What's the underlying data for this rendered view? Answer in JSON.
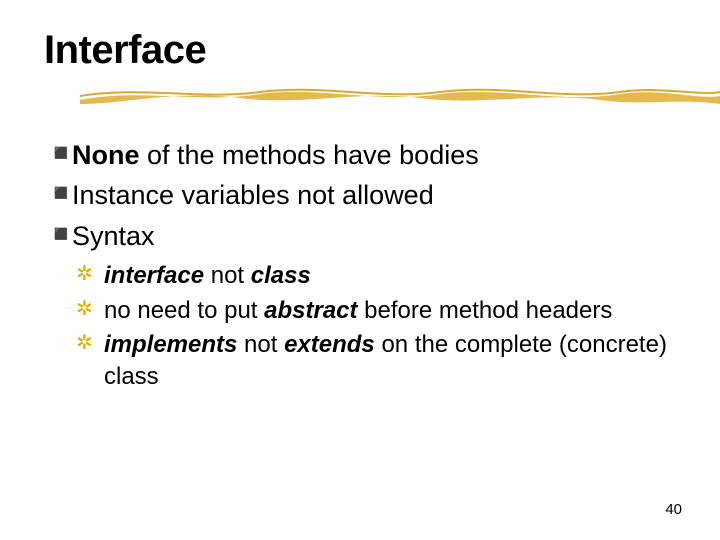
{
  "title": "Interface",
  "bullets": {
    "l1a": {
      "strong": "None",
      "rest": " of the methods have bodies"
    },
    "l1b": "Instance variables not allowed",
    "l1c": "Syntax"
  },
  "sub": {
    "s1": {
      "i1": "interface",
      "mid": " not ",
      "i2": "class"
    },
    "s2": {
      "pre": "no need to put ",
      "i1": "abstract",
      "post": " before method headers"
    },
    "s3": {
      "i1": "implements",
      "mid": " not ",
      "i2": "extends",
      "post": " on the complete (concrete) class"
    }
  },
  "page": "40"
}
